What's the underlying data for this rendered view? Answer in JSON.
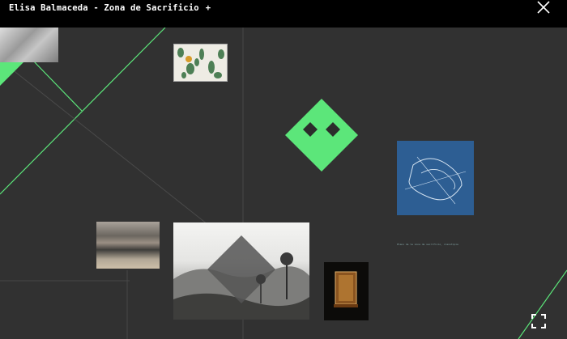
{
  "header": {
    "title": "Elisa Balmaceda - Zona de Sacrificio",
    "add_label": "+"
  },
  "colors": {
    "accent": "#5ce67a",
    "background": "#313131",
    "topbar": "#000000",
    "blueprint": "#2d5e93"
  },
  "icons": {
    "close": "close-icon",
    "fullscreen": "fullscreen-icon",
    "logo": "diamond-face-logo"
  },
  "gallery": {
    "blueprint_caption": "Plano de la zona de sacrificio, cianotipia"
  }
}
